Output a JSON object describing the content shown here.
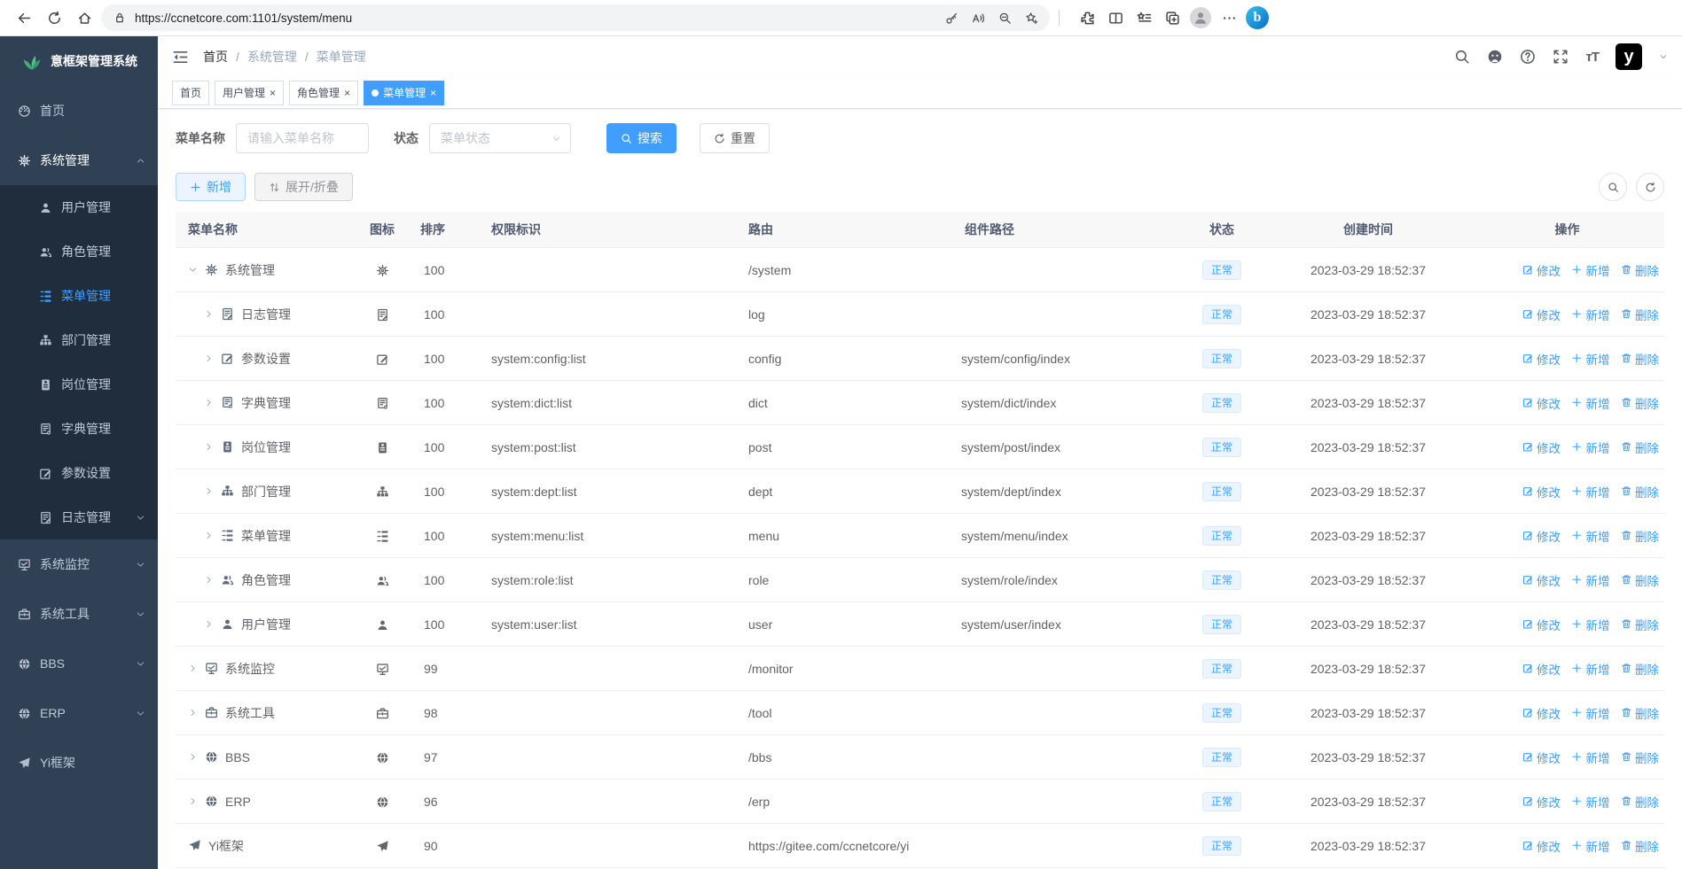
{
  "colors": {
    "accent": "#409eff",
    "sidebar_bg": "#304156",
    "submenu_bg": "#1f2d3d",
    "sidebar_text": "#bfcbd9",
    "status_tag_bg": "#ecf5ff",
    "status_tag_text": "#409eff",
    "active_tab_bg": "#409eff",
    "logo_green": "#3eaf7c"
  },
  "browser": {
    "url": "https://ccnetcore.com:1101/system/menu",
    "toolbar_icons": [
      "back",
      "reload",
      "home",
      "lock",
      "key",
      "read-aloud",
      "zoom-out",
      "favorite-add",
      "extensions",
      "split-screen",
      "favorites-bar",
      "collections",
      "profile",
      "more-menu",
      "bing-chat"
    ]
  },
  "app": {
    "title": "意框架管理系统"
  },
  "sidebar": {
    "items": [
      {
        "key": "home",
        "label": "首页",
        "icon": "dashboard"
      },
      {
        "key": "system",
        "label": "系统管理",
        "icon": "gear",
        "open": true,
        "caret": "up",
        "children": [
          {
            "key": "user",
            "label": "用户管理",
            "icon": "user"
          },
          {
            "key": "role",
            "label": "角色管理",
            "icon": "users"
          },
          {
            "key": "menu",
            "label": "菜单管理",
            "icon": "tree",
            "active": true
          },
          {
            "key": "dept",
            "label": "部门管理",
            "icon": "org"
          },
          {
            "key": "post",
            "label": "岗位管理",
            "icon": "badge"
          },
          {
            "key": "dict",
            "label": "字典管理",
            "icon": "book"
          },
          {
            "key": "config",
            "label": "参数设置",
            "icon": "edit"
          },
          {
            "key": "log",
            "label": "日志管理",
            "icon": "doc",
            "caret": "down"
          }
        ]
      },
      {
        "key": "monitor",
        "label": "系统监控",
        "icon": "monitor",
        "caret": "down"
      },
      {
        "key": "tool",
        "label": "系统工具",
        "icon": "tool",
        "caret": "down"
      },
      {
        "key": "bbs",
        "label": "BBS",
        "icon": "globe",
        "caret": "down"
      },
      {
        "key": "erp",
        "label": "ERP",
        "icon": "globe",
        "caret": "down"
      },
      {
        "key": "yi",
        "label": "Yi框架",
        "icon": "plane"
      }
    ]
  },
  "header": {
    "breadcrumb": [
      "首页",
      "系统管理",
      "菜单管理"
    ]
  },
  "tabs": [
    {
      "label": "首页",
      "closable": false,
      "active": false
    },
    {
      "label": "用户管理",
      "closable": true,
      "active": false
    },
    {
      "label": "角色管理",
      "closable": true,
      "active": false
    },
    {
      "label": "菜单管理",
      "closable": true,
      "active": true
    }
  ],
  "filter": {
    "name_label": "菜单名称",
    "name_placeholder": "请输入菜单名称",
    "name_value": "",
    "status_label": "状态",
    "status_placeholder": "菜单状态",
    "search_label": "搜索",
    "reset_label": "重置"
  },
  "toolbar": {
    "add_label": "新增",
    "expand_label": "展开/折叠"
  },
  "table": {
    "columns": [
      "菜单名称",
      "图标",
      "排序",
      "权限标识",
      "路由",
      "组件路径",
      "状态",
      "创建时间",
      "操作"
    ],
    "action_labels": {
      "edit": "修改",
      "add": "新增",
      "del": "删除"
    },
    "rows": [
      {
        "name": "系统管理",
        "icon": "gear",
        "caret": "open",
        "level": 0,
        "sort": "100",
        "perms": "",
        "router": "/system",
        "component": "",
        "status": "正常",
        "time": "2023-03-29 18:52:37"
      },
      {
        "name": "日志管理",
        "icon": "doc",
        "caret": "closed",
        "level": 1,
        "sort": "100",
        "perms": "",
        "router": "log",
        "component": "",
        "status": "正常",
        "time": "2023-03-29 18:52:37"
      },
      {
        "name": "参数设置",
        "icon": "edit",
        "caret": "closed",
        "level": 1,
        "sort": "100",
        "perms": "system:config:list",
        "router": "config",
        "component": "system/config/index",
        "status": "正常",
        "time": "2023-03-29 18:52:37"
      },
      {
        "name": "字典管理",
        "icon": "book",
        "caret": "closed",
        "level": 1,
        "sort": "100",
        "perms": "system:dict:list",
        "router": "dict",
        "component": "system/dict/index",
        "status": "正常",
        "time": "2023-03-29 18:52:37"
      },
      {
        "name": "岗位管理",
        "icon": "badge",
        "caret": "closed",
        "level": 1,
        "sort": "100",
        "perms": "system:post:list",
        "router": "post",
        "component": "system/post/index",
        "status": "正常",
        "time": "2023-03-29 18:52:37"
      },
      {
        "name": "部门管理",
        "icon": "org",
        "caret": "closed",
        "level": 1,
        "sort": "100",
        "perms": "system:dept:list",
        "router": "dept",
        "component": "system/dept/index",
        "status": "正常",
        "time": "2023-03-29 18:52:37"
      },
      {
        "name": "菜单管理",
        "icon": "tree",
        "caret": "closed",
        "level": 1,
        "sort": "100",
        "perms": "system:menu:list",
        "router": "menu",
        "component": "system/menu/index",
        "status": "正常",
        "time": "2023-03-29 18:52:37"
      },
      {
        "name": "角色管理",
        "icon": "users",
        "caret": "closed",
        "level": 1,
        "sort": "100",
        "perms": "system:role:list",
        "router": "role",
        "component": "system/role/index",
        "status": "正常",
        "time": "2023-03-29 18:52:37"
      },
      {
        "name": "用户管理",
        "icon": "user",
        "caret": "closed",
        "level": 1,
        "sort": "100",
        "perms": "system:user:list",
        "router": "user",
        "component": "system/user/index",
        "status": "正常",
        "time": "2023-03-29 18:52:37"
      },
      {
        "name": "系统监控",
        "icon": "monitor",
        "caret": "closed",
        "level": 0,
        "sort": "99",
        "perms": "",
        "router": "/monitor",
        "component": "",
        "status": "正常",
        "time": "2023-03-29 18:52:37"
      },
      {
        "name": "系统工具",
        "icon": "tool",
        "caret": "closed",
        "level": 0,
        "sort": "98",
        "perms": "",
        "router": "/tool",
        "component": "",
        "status": "正常",
        "time": "2023-03-29 18:52:37"
      },
      {
        "name": "BBS",
        "icon": "globe",
        "caret": "closed",
        "level": 0,
        "sort": "97",
        "perms": "",
        "router": "/bbs",
        "component": "",
        "status": "正常",
        "time": "2023-03-29 18:52:37"
      },
      {
        "name": "ERP",
        "icon": "globe",
        "caret": "closed",
        "level": 0,
        "sort": "96",
        "perms": "",
        "router": "/erp",
        "component": "",
        "status": "正常",
        "time": "2023-03-29 18:52:37"
      },
      {
        "name": "Yi框架",
        "icon": "plane",
        "caret": "none",
        "level": 0,
        "sort": "90",
        "perms": "",
        "router": "https://gitee.com/ccnetcore/yi",
        "component": "",
        "status": "正常",
        "time": "2023-03-29 18:52:37"
      }
    ]
  }
}
